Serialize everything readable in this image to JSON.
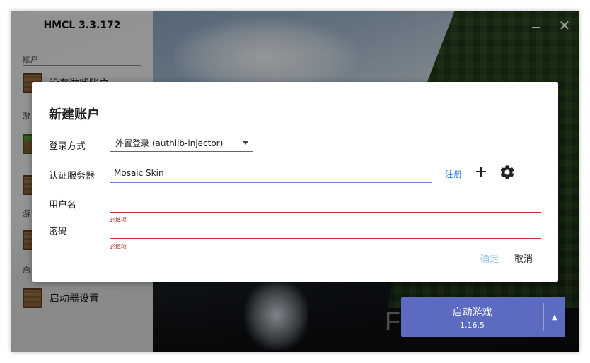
{
  "app": {
    "title": "HMCL 3.3.172",
    "controls": {
      "minimize_icon": "minimize-icon",
      "close_icon": "close-icon",
      "close_glyph": "✕"
    }
  },
  "sidebar": {
    "account_section_label": "账户",
    "items": [
      {
        "label": "没有游戏账户",
        "icon": "crafting-table-icon"
      },
      {
        "label": "",
        "icon": "grass-block-icon"
      },
      {
        "label": "",
        "icon": "crafting-table-icon"
      },
      {
        "label": "",
        "icon": "crafting-table-icon"
      },
      {
        "label": "启动器设置",
        "icon": "crafting-table-icon"
      }
    ],
    "partial_labels": [
      "游",
      "游",
      "启"
    ]
  },
  "launch": {
    "title": "启动游戏",
    "version": "1.16.5",
    "arrow": "▲"
  },
  "watermark": "FatBlog",
  "dialog": {
    "title": "新建账户",
    "login_method": {
      "label": "登录方式",
      "value": "外置登录 (authlib-injector)"
    },
    "auth_server": {
      "label": "认证服务器",
      "value": "Mosaic Skin",
      "register_link": "注册"
    },
    "username": {
      "label": "用户名",
      "value": "",
      "error": "必填项"
    },
    "password": {
      "label": "密码",
      "value": "",
      "error": "必填项"
    },
    "buttons": {
      "confirm": "确定",
      "cancel": "取消"
    }
  },
  "colors": {
    "accent": "#5c6bc0",
    "link": "#2a82da",
    "error": "#c0392b",
    "focus_underline": "#6f7bd0",
    "confirm_disabled": "#9fc9ec"
  }
}
